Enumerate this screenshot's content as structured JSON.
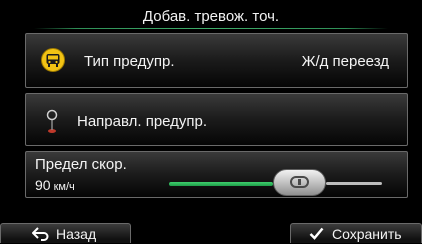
{
  "header": {
    "title": "Добав. тревож. точ."
  },
  "alert_type": {
    "label": "Тип предупр.",
    "value": "Ж/д переезд",
    "icon": "railroad-crossing-icon"
  },
  "alert_direction": {
    "label": "Направл. предупр.",
    "icon": "map-pin-icon"
  },
  "speed_limit": {
    "label": "Предел скор.",
    "value": "90",
    "unit": "км/ч"
  },
  "footer": {
    "back_label": "Назад",
    "save_label": "Сохранить"
  },
  "colors": {
    "accent": "#2fbf5f",
    "background": "#000000",
    "icon_yellow": "#f2c314"
  }
}
